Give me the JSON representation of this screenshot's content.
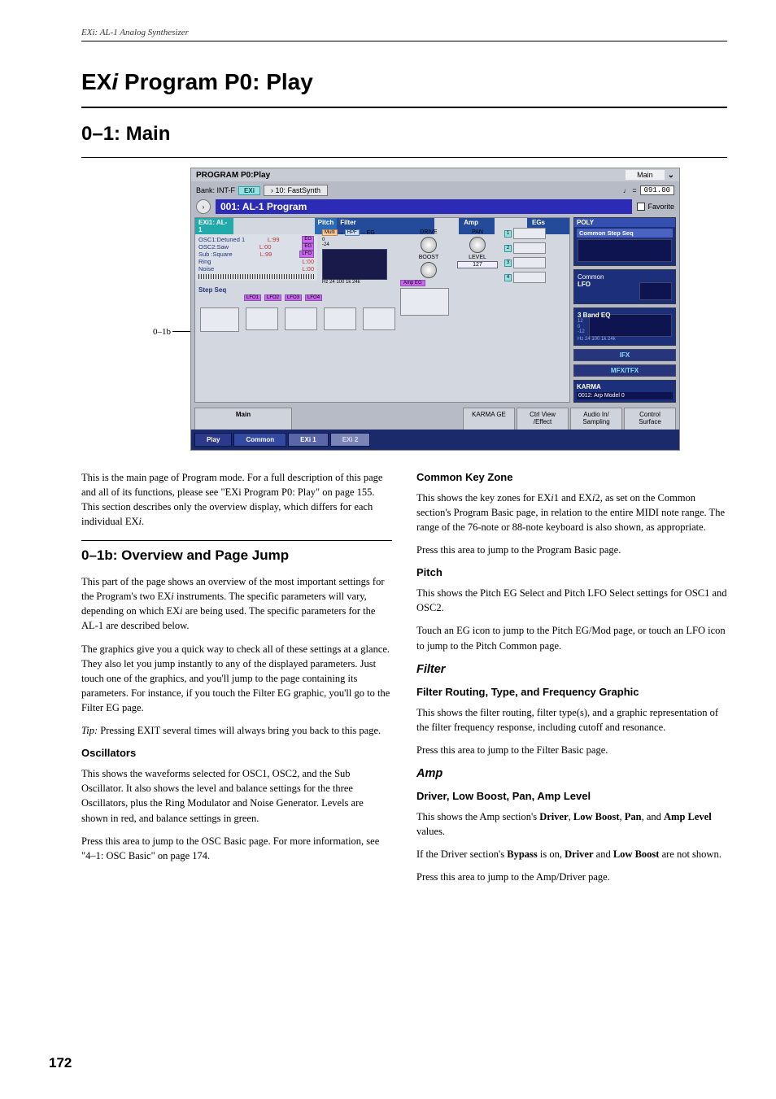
{
  "runningHead": "EXi: AL-1 Analog Synthesizer",
  "title1_a": "EX",
  "title1_b": "i",
  "title1_c": " Program P0: Play",
  "title2": "0–1: Main",
  "callout": "0–1b",
  "shot": {
    "topTitle": "PROGRAM P0:Play",
    "mainTab": "Main",
    "bankLabel": "Bank: INT-F",
    "exiBadge": "EXi",
    "categorySel": "10: FastSynth",
    "tempoPrefix": "♩ =",
    "tempoValue": "091.00",
    "progTitle": "001: AL-1 Program",
    "favorite": "Favorite",
    "exiName": "EXi1: AL-1",
    "hdr_pitch": "Pitch",
    "hdr_filter": "Filter",
    "hdr_amp": "Amp",
    "hdr_egs": "EGs",
    "osc": [
      {
        "n": "OSC1:Detuned 1",
        "l": "L:99"
      },
      {
        "n": "OSC2:Saw",
        "l": "L:00"
      },
      {
        "n": "Sub  :Square",
        "l": "L:99"
      },
      {
        "n": "Ring",
        "l": "L:00"
      },
      {
        "n": "Noise",
        "l": "L:00"
      }
    ],
    "stepSeq": "Step Seq",
    "filter_multi": "Multi",
    "filter_hpf": "HPF",
    "filt_axis": "Hz 24 100   1k      24k",
    "amp_drive": "DRIVE",
    "amp_boost": "BOOST",
    "amp_pan": "PAN",
    "amp_level": "LEVEL",
    "amp_levelval": "127",
    "ampEG_tag": "Amp EG",
    "lfoTags": [
      "LFO1",
      "LFO2",
      "LFO3",
      "LFO4"
    ],
    "eg_nums": [
      "1",
      "2",
      "3",
      "4"
    ],
    "side_poly": "POLY",
    "side_css": "Common Step Seq",
    "side_commonLfo_a": "Common",
    "side_commonLfo_b": "LFO",
    "side_eq": "3 Band EQ",
    "side_eq_scale_a": "12",
    "side_eq_scale_b": "0",
    "side_eq_scale_c": "-12",
    "side_eq_axis": "Hz 24 100   1k      24k",
    "side_ifx": "IFX",
    "side_mfx": "MFX/TFX",
    "side_karma": "KARMA",
    "side_karma_ge": "0012: Arp Model 0",
    "btabs": {
      "main": "Main",
      "karmage": "KARMA GE",
      "ctrl": "Ctrl View\n/Effect",
      "audio": "Audio In/\nSampling",
      "surf": "Control\nSurface"
    },
    "ltabs": [
      "Play",
      "Common",
      "EXi 1",
      "EXi 2"
    ]
  },
  "left": {
    "p1a": "This is the main page of Program mode. For a full description of this page and all of its functions, please see \"EXi Program P0: Play\" on page 155. This section describes only the overview display, which differs for each individual EX",
    "p1b": "i",
    "p1c": ".",
    "h_01b": "0–1b: Overview and Page Jump",
    "p2a": "This part of the page shows an overview of the most important settings for the Program's two EX",
    "p2b": "i",
    "p2c": " instruments. The specific parameters will vary, depending on which EX",
    "p2d": "i",
    "p2e": " are being used. The specific parameters for the AL-1 are described below.",
    "p3": "The graphics give you a quick way to check all of these settings at a glance. They also let you jump instantly to any of the displayed parameters. Just touch one of the graphics, and you'll jump to the page containing its parameters. For instance, if you touch the Filter EG graphic, you'll go to the Filter EG page.",
    "p4a": "Tip:",
    "p4b": " Pressing EXIT several times will always bring you back to this page.",
    "h_osc": "Oscillators",
    "p5": "This shows the waveforms selected for OSC1, OSC2, and the Sub Oscillator. It also shows the level and balance settings for the three Oscillators, plus the Ring Modulator and Noise Generator. Levels are shown in red, and balance settings in green.",
    "p6": "Press this area to jump to the OSC Basic page. For more information, see \"4–1: OSC Basic\" on page 174."
  },
  "right": {
    "h_ckz": "Common Key Zone",
    "p1a": "This shows the key zones for EX",
    "p1b": "i",
    "p1c": "1 and EX",
    "p1d": "i",
    "p1e": "2, as set on the Common section's Program Basic page, in relation to the entire MIDI note range. The range of the 76-note or 88-note keyboard is also shown, as appropriate.",
    "p2": "Press this area to jump to the Program Basic page.",
    "h_pitch": "Pitch",
    "p3": "This shows the Pitch EG Select and Pitch LFO Select settings for OSC1 and OSC2.",
    "p4": "Touch an EG icon to jump to the Pitch EG/Mod page, or touch an LFO icon to jump to the Pitch Common page.",
    "h_filter": "Filter",
    "h_frt": "Filter Routing, Type, and Frequency Graphic",
    "p5": "This shows the filter routing, filter type(s), and a graphic representation of the filter frequency response, including cutoff and resonance.",
    "p6": "Press this area to jump to the Filter Basic page.",
    "h_amp": "Amp",
    "h_dlb": "Driver, Low Boost, Pan, Amp Level",
    "p7a": "This shows the Amp section's ",
    "p7b": "Driver",
    "p7c": ", ",
    "p7d": "Low Boost",
    "p7e": ", ",
    "p7f": "Pan",
    "p7g": ", and ",
    "p7h": "Amp Level",
    "p7i": " values.",
    "p8a": "If the Driver section's ",
    "p8b": "Bypass",
    "p8c": " is on, ",
    "p8d": "Driver",
    "p8e": " and ",
    "p8f": "Low Boost",
    "p8g": " are not shown.",
    "p9": "Press this area to jump to the Amp/Driver page."
  },
  "pageNum": "172"
}
